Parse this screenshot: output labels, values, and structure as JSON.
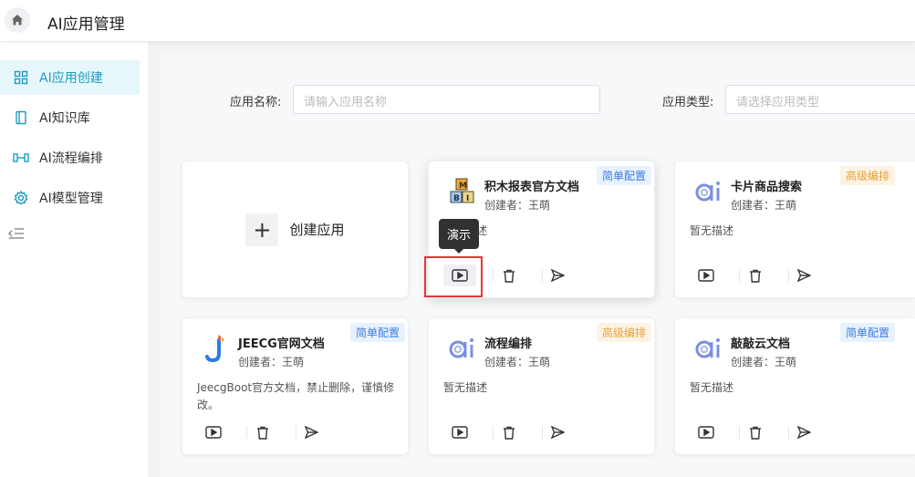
{
  "header": {
    "title": "AI应用管理"
  },
  "sidebar": {
    "items": [
      {
        "label": "AI应用创建",
        "icon": "grid-icon",
        "active": true
      },
      {
        "label": "AI知识库",
        "icon": "book-icon",
        "active": false
      },
      {
        "label": "AI流程编排",
        "icon": "flow-icon",
        "active": false
      },
      {
        "label": "AI模型管理",
        "icon": "gear-icon",
        "active": false
      }
    ]
  },
  "filters": {
    "app_name_label": "应用名称:",
    "app_name_placeholder": "请输入应用名称",
    "app_type_label": "应用类型:",
    "app_type_placeholder": "请选择应用类型"
  },
  "create_card": {
    "label": "创建应用"
  },
  "tooltip": {
    "text": "演示"
  },
  "cards": [
    {
      "name": "积木报表官方文档",
      "creator": "创建者：王萌",
      "badge": "简单配置",
      "desc": "暂无描述",
      "logo": "jimu-logo"
    },
    {
      "name": "卡片商品搜索",
      "creator": "创建者：王萌",
      "badge": "高级编排",
      "desc": "暂无描述",
      "logo": "ai-logo"
    },
    {
      "name": "JEECG官网文档",
      "creator": "创建者：王萌",
      "badge": "简单配置",
      "desc": "JeecgBoot官方文档，禁止删除，谨慎修改。",
      "logo": "jeecg-logo"
    },
    {
      "name": "流程编排",
      "creator": "创建者：王萌",
      "badge": "高级编排",
      "desc": "暂无描述",
      "logo": "ai-logo"
    },
    {
      "name": "敲敲云文档",
      "creator": "创建者：王萌",
      "badge": "简单配置",
      "desc": "暂无描述",
      "logo": "ai-logo"
    }
  ],
  "colors": {
    "accent": "#1f9bbf",
    "simple_badge": "#3b7de0",
    "advanced_badge": "#e7a139",
    "highlight": "#e53935"
  }
}
